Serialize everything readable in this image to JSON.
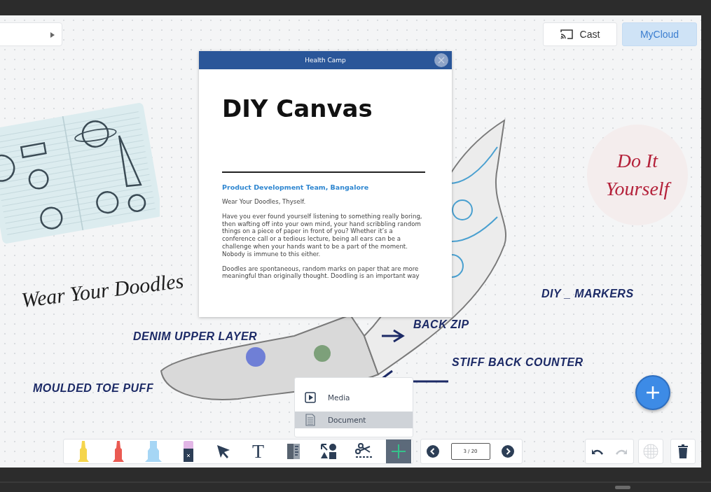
{
  "top_bar": {
    "cast_button": {
      "label": "Cast"
    },
    "cloud_button": {
      "label": "MyCloud"
    }
  },
  "canvas": {
    "labels": [
      {
        "text": "Wear Your Doodles",
        "kind": "script"
      },
      {
        "text": "DIY _ MARKERS",
        "kind": "marker"
      },
      {
        "text": "BACK ZIP",
        "kind": "marker"
      },
      {
        "text": "DENIM UPPER LAYER",
        "kind": "marker"
      },
      {
        "text": "STIFF BACK COUNTER",
        "kind": "marker"
      },
      {
        "text": "MOULDED TOE PUFF",
        "kind": "marker"
      }
    ],
    "badge": {
      "line_1": "Do It",
      "line_2": "Yourself"
    }
  },
  "dialog": {
    "title": "Health Camp",
    "heading": "DIY Canvas",
    "byline": "Product Development Team, Bangalore",
    "paragraphs": [
      "Wear Your Doodles, Thyself.",
      "Have you ever found yourself listening to something really boring, then wafting off into your own mind, your hand scribbling random things on a piece of paper in front of you? Whether it’s a conference call or a tedious lecture, being all ears can be a challenge when your hands want to be a part of the moment. Nobody is immune to this either.",
      "Doodles are spontaneous, random marks on paper that are more meaningful than originally thought. Doodling is an important way"
    ]
  },
  "add_menu": {
    "items": [
      {
        "label": "Media",
        "kind": "media",
        "selected": false
      },
      {
        "label": "Document",
        "kind": "document",
        "selected": true
      }
    ]
  },
  "toolbar": {
    "tools": [
      {
        "kind": "marker",
        "color": "#f5d54c",
        "selected": false
      },
      {
        "kind": "marker",
        "color": "#ea5a52",
        "selected": false
      },
      {
        "kind": "highlighter",
        "color": "#a6d6f5",
        "selected": false
      },
      {
        "kind": "eraser",
        "selected": false
      },
      {
        "kind": "pointer",
        "selected": false
      },
      {
        "kind": "text",
        "glyph": "T",
        "selected": false
      },
      {
        "kind": "ruler",
        "selected": false
      },
      {
        "kind": "shapes",
        "selected": false
      },
      {
        "kind": "scissors",
        "selected": false
      },
      {
        "kind": "add",
        "selected": true
      }
    ]
  },
  "pager": {
    "page": "3 / 20"
  },
  "history": [
    {
      "kind": "undo",
      "disabled": false
    },
    {
      "kind": "redo",
      "disabled": true
    }
  ],
  "grid_button": {
    "disabled": true
  }
}
